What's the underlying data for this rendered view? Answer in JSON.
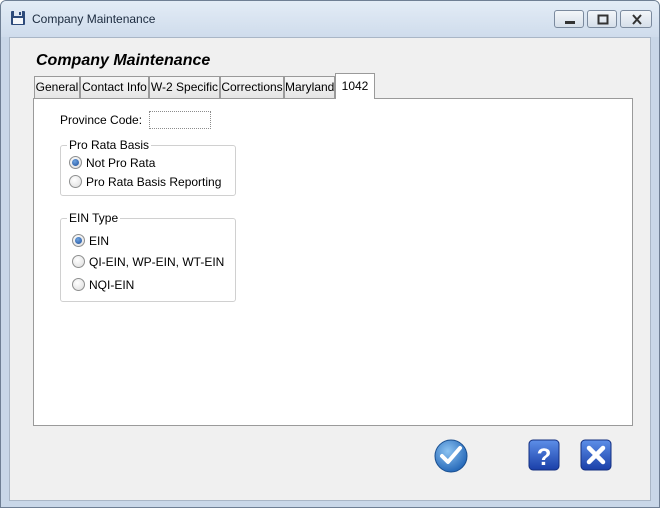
{
  "window": {
    "title": "Company Maintenance"
  },
  "form": {
    "heading": "Company Maintenance"
  },
  "tabs": [
    {
      "label": "General",
      "active": false
    },
    {
      "label": "Contact Info",
      "active": false
    },
    {
      "label": "W-2 Specific",
      "active": false
    },
    {
      "label": "Corrections",
      "active": false
    },
    {
      "label": "Maryland",
      "active": false
    },
    {
      "label": "1042",
      "active": true
    }
  ],
  "province": {
    "label": "Province Code:",
    "value": ""
  },
  "pro_rata": {
    "legend": "Pro Rata Basis",
    "options": [
      {
        "label": "Not Pro Rata",
        "checked": true
      },
      {
        "label": "Pro Rata Basis Reporting",
        "checked": false
      }
    ]
  },
  "ein_type": {
    "legend": "EIN Type",
    "options": [
      {
        "label": "EIN",
        "checked": true
      },
      {
        "label": "QI-EIN, WP-EIN, WT-EIN",
        "checked": false
      },
      {
        "label": "NQI-EIN",
        "checked": false
      }
    ]
  },
  "colors": {
    "ok_button": "#3b86d3",
    "help_button": "#2a5bd0",
    "cancel_button": "#2a5bd0",
    "window_frame": "#c9d7e8"
  },
  "icons": {
    "title": "floppy-disk-icon",
    "ok": "checkmark-icon",
    "help": "question-mark-icon",
    "cancel": "x-close-icon"
  }
}
